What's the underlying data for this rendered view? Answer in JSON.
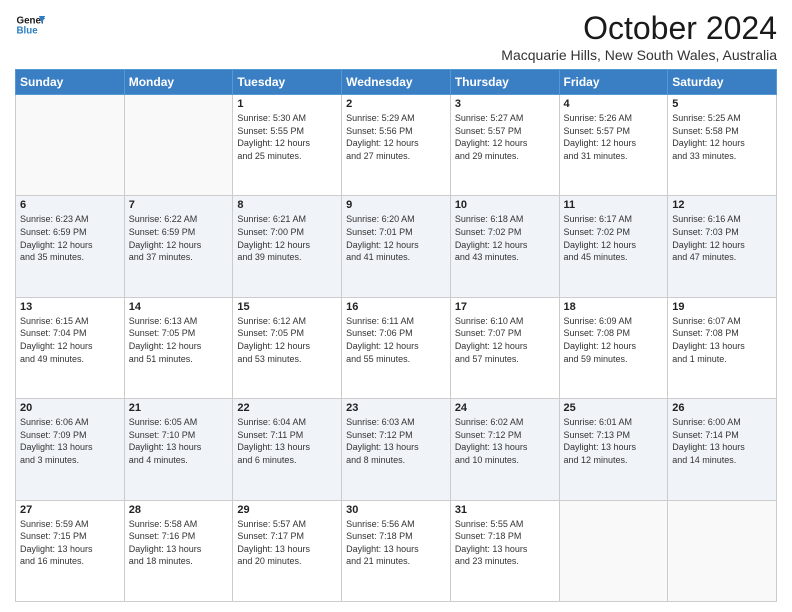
{
  "header": {
    "logo_line1": "General",
    "logo_line2": "Blue",
    "month": "October 2024",
    "location": "Macquarie Hills, New South Wales, Australia"
  },
  "weekdays": [
    "Sunday",
    "Monday",
    "Tuesday",
    "Wednesday",
    "Thursday",
    "Friday",
    "Saturday"
  ],
  "weeks": [
    [
      {
        "day": "",
        "info": ""
      },
      {
        "day": "",
        "info": ""
      },
      {
        "day": "1",
        "info": "Sunrise: 5:30 AM\nSunset: 5:55 PM\nDaylight: 12 hours\nand 25 minutes."
      },
      {
        "day": "2",
        "info": "Sunrise: 5:29 AM\nSunset: 5:56 PM\nDaylight: 12 hours\nand 27 minutes."
      },
      {
        "day": "3",
        "info": "Sunrise: 5:27 AM\nSunset: 5:57 PM\nDaylight: 12 hours\nand 29 minutes."
      },
      {
        "day": "4",
        "info": "Sunrise: 5:26 AM\nSunset: 5:57 PM\nDaylight: 12 hours\nand 31 minutes."
      },
      {
        "day": "5",
        "info": "Sunrise: 5:25 AM\nSunset: 5:58 PM\nDaylight: 12 hours\nand 33 minutes."
      }
    ],
    [
      {
        "day": "6",
        "info": "Sunrise: 6:23 AM\nSunset: 6:59 PM\nDaylight: 12 hours\nand 35 minutes."
      },
      {
        "day": "7",
        "info": "Sunrise: 6:22 AM\nSunset: 6:59 PM\nDaylight: 12 hours\nand 37 minutes."
      },
      {
        "day": "8",
        "info": "Sunrise: 6:21 AM\nSunset: 7:00 PM\nDaylight: 12 hours\nand 39 minutes."
      },
      {
        "day": "9",
        "info": "Sunrise: 6:20 AM\nSunset: 7:01 PM\nDaylight: 12 hours\nand 41 minutes."
      },
      {
        "day": "10",
        "info": "Sunrise: 6:18 AM\nSunset: 7:02 PM\nDaylight: 12 hours\nand 43 minutes."
      },
      {
        "day": "11",
        "info": "Sunrise: 6:17 AM\nSunset: 7:02 PM\nDaylight: 12 hours\nand 45 minutes."
      },
      {
        "day": "12",
        "info": "Sunrise: 6:16 AM\nSunset: 7:03 PM\nDaylight: 12 hours\nand 47 minutes."
      }
    ],
    [
      {
        "day": "13",
        "info": "Sunrise: 6:15 AM\nSunset: 7:04 PM\nDaylight: 12 hours\nand 49 minutes."
      },
      {
        "day": "14",
        "info": "Sunrise: 6:13 AM\nSunset: 7:05 PM\nDaylight: 12 hours\nand 51 minutes."
      },
      {
        "day": "15",
        "info": "Sunrise: 6:12 AM\nSunset: 7:05 PM\nDaylight: 12 hours\nand 53 minutes."
      },
      {
        "day": "16",
        "info": "Sunrise: 6:11 AM\nSunset: 7:06 PM\nDaylight: 12 hours\nand 55 minutes."
      },
      {
        "day": "17",
        "info": "Sunrise: 6:10 AM\nSunset: 7:07 PM\nDaylight: 12 hours\nand 57 minutes."
      },
      {
        "day": "18",
        "info": "Sunrise: 6:09 AM\nSunset: 7:08 PM\nDaylight: 12 hours\nand 59 minutes."
      },
      {
        "day": "19",
        "info": "Sunrise: 6:07 AM\nSunset: 7:08 PM\nDaylight: 13 hours\nand 1 minute."
      }
    ],
    [
      {
        "day": "20",
        "info": "Sunrise: 6:06 AM\nSunset: 7:09 PM\nDaylight: 13 hours\nand 3 minutes."
      },
      {
        "day": "21",
        "info": "Sunrise: 6:05 AM\nSunset: 7:10 PM\nDaylight: 13 hours\nand 4 minutes."
      },
      {
        "day": "22",
        "info": "Sunrise: 6:04 AM\nSunset: 7:11 PM\nDaylight: 13 hours\nand 6 minutes."
      },
      {
        "day": "23",
        "info": "Sunrise: 6:03 AM\nSunset: 7:12 PM\nDaylight: 13 hours\nand 8 minutes."
      },
      {
        "day": "24",
        "info": "Sunrise: 6:02 AM\nSunset: 7:12 PM\nDaylight: 13 hours\nand 10 minutes."
      },
      {
        "day": "25",
        "info": "Sunrise: 6:01 AM\nSunset: 7:13 PM\nDaylight: 13 hours\nand 12 minutes."
      },
      {
        "day": "26",
        "info": "Sunrise: 6:00 AM\nSunset: 7:14 PM\nDaylight: 13 hours\nand 14 minutes."
      }
    ],
    [
      {
        "day": "27",
        "info": "Sunrise: 5:59 AM\nSunset: 7:15 PM\nDaylight: 13 hours\nand 16 minutes."
      },
      {
        "day": "28",
        "info": "Sunrise: 5:58 AM\nSunset: 7:16 PM\nDaylight: 13 hours\nand 18 minutes."
      },
      {
        "day": "29",
        "info": "Sunrise: 5:57 AM\nSunset: 7:17 PM\nDaylight: 13 hours\nand 20 minutes."
      },
      {
        "day": "30",
        "info": "Sunrise: 5:56 AM\nSunset: 7:18 PM\nDaylight: 13 hours\nand 21 minutes."
      },
      {
        "day": "31",
        "info": "Sunrise: 5:55 AM\nSunset: 7:18 PM\nDaylight: 13 hours\nand 23 minutes."
      },
      {
        "day": "",
        "info": ""
      },
      {
        "day": "",
        "info": ""
      }
    ]
  ]
}
